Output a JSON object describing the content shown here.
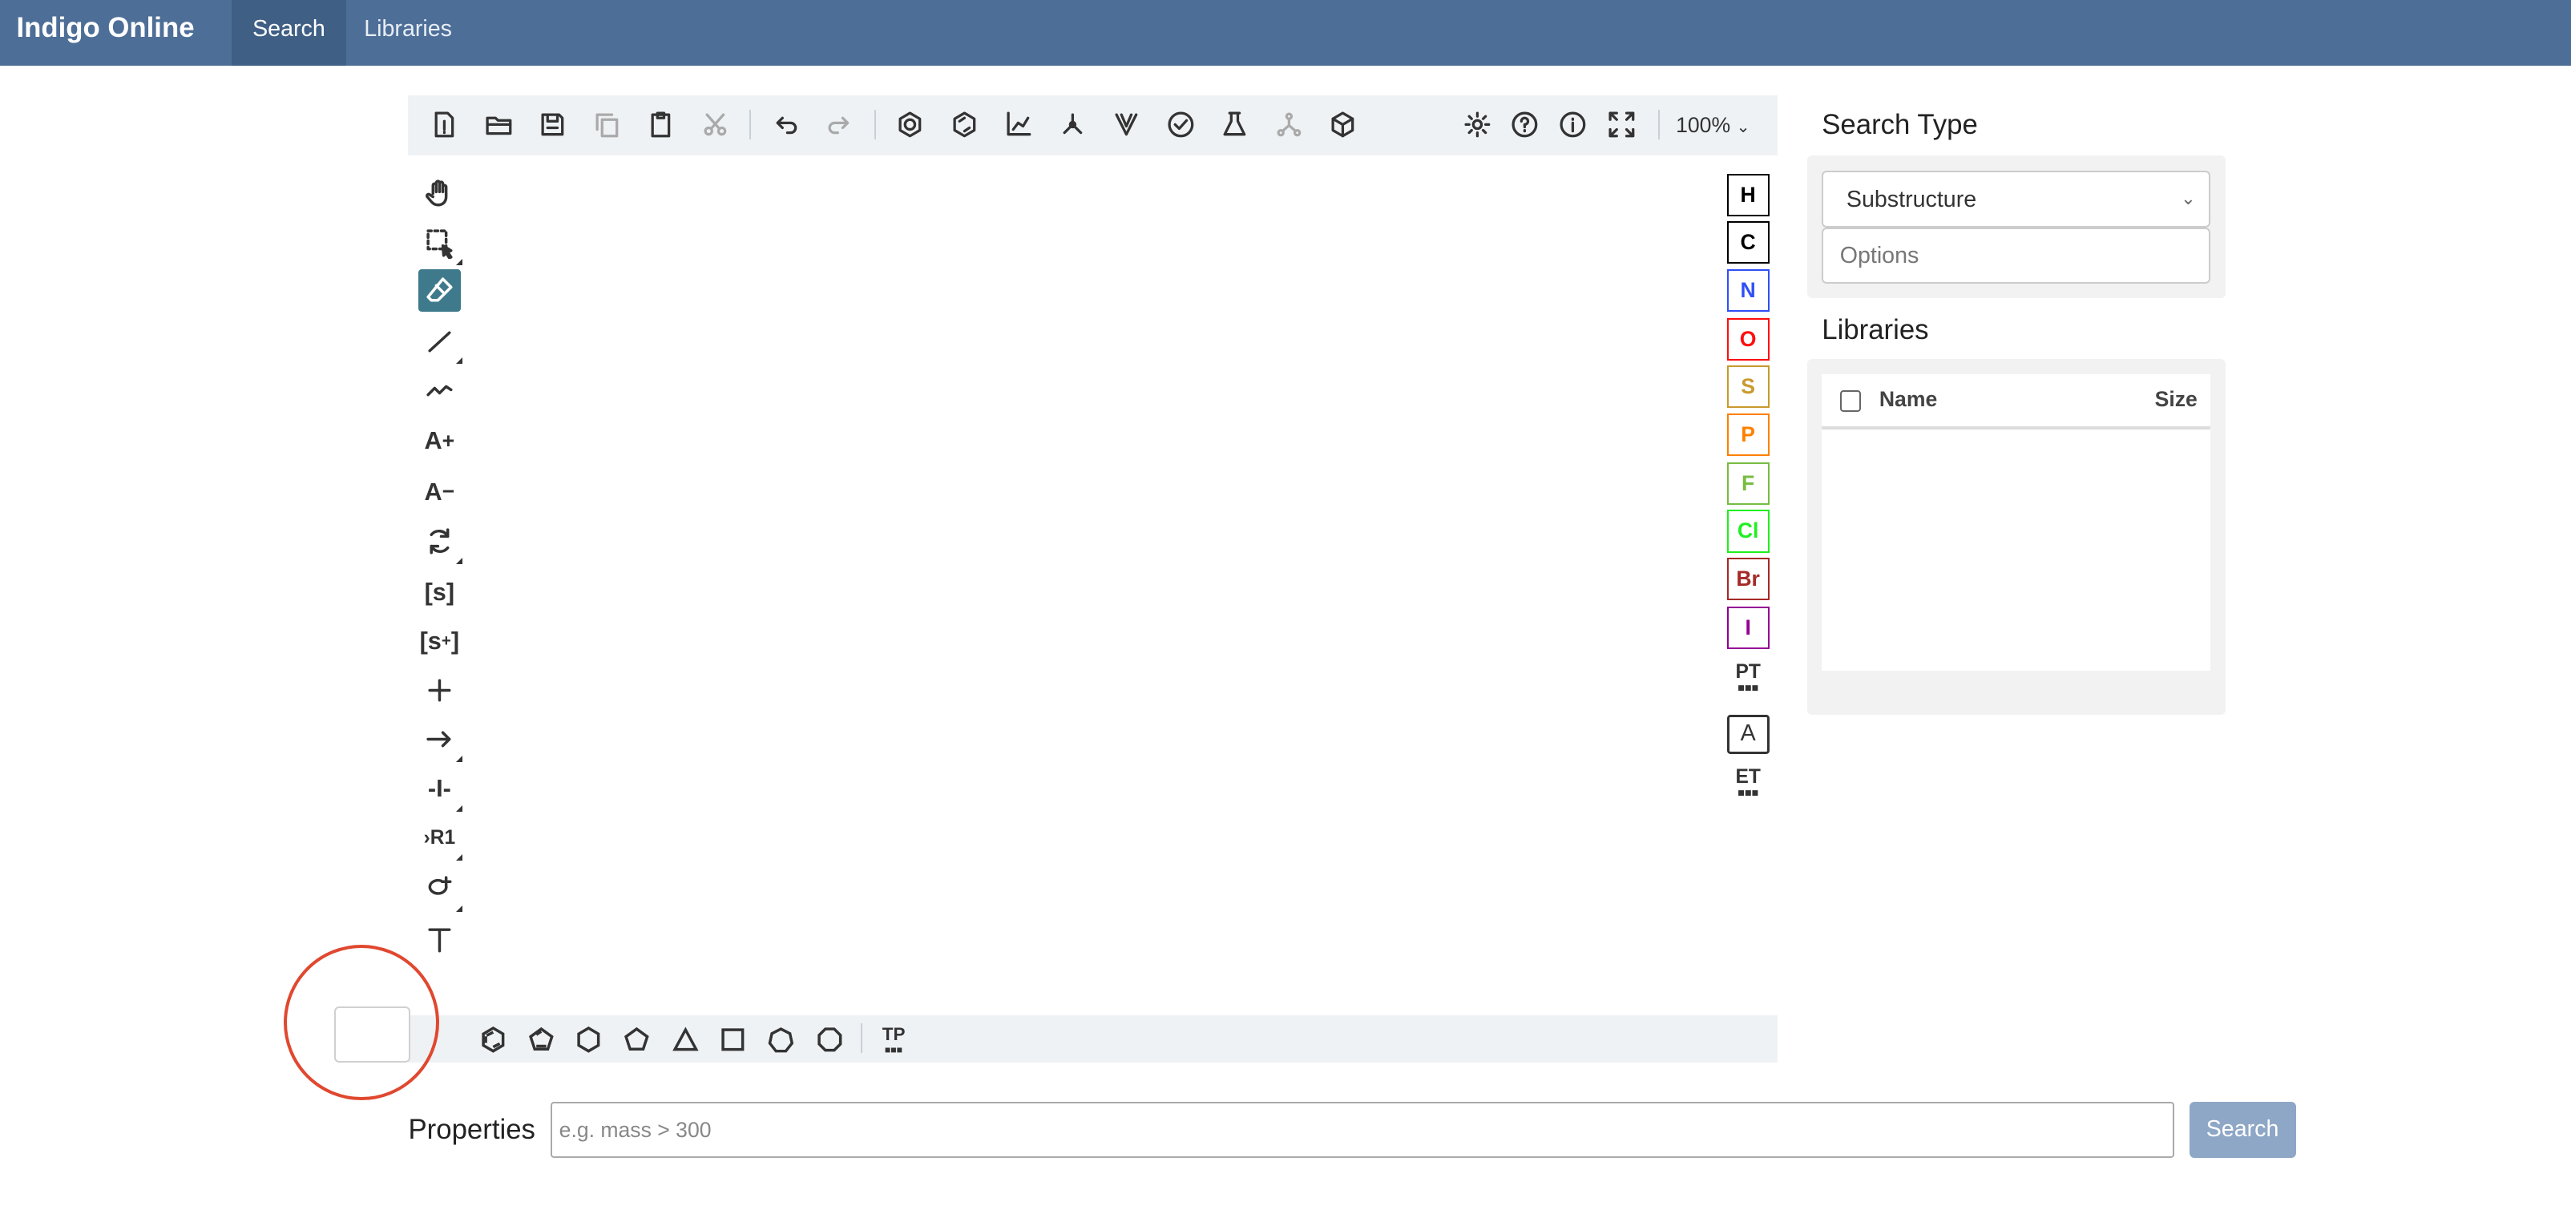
{
  "nav": {
    "brand": "Indigo Online",
    "tabs": [
      {
        "label": "Search"
      },
      {
        "label": "Libraries"
      }
    ]
  },
  "editor": {
    "zoom": "100%",
    "top_icons": [
      "new-file-icon",
      "open-icon",
      "save-icon",
      "copy-icon",
      "paste-icon",
      "cut-icon",
      "undo-icon",
      "redo-icon",
      "aromatize-icon",
      "dearomatize-icon",
      "layout-icon",
      "clean-icon",
      "stereo-icon",
      "check-icon",
      "analyse-icon",
      "recognize-icon",
      "3d-view-icon",
      "settings-icon",
      "help-icon",
      "about-icon",
      "fullscreen-icon"
    ],
    "left_tools": [
      "hand-tool",
      "select-tool",
      "erase-tool",
      "bond-tool",
      "chain-tool",
      "charge-plus",
      "charge-minus",
      "transform-tool",
      "sgroup-tool",
      "sgroup-data-tool",
      "reaction-plus-tool",
      "arrow-tool",
      "mapping-tool",
      "rgroup-tool",
      "attachment-tool",
      "text-tool"
    ],
    "atoms": [
      {
        "label": "H",
        "color": "#000000"
      },
      {
        "label": "C",
        "color": "#000000"
      },
      {
        "label": "N",
        "color": "#304ff7"
      },
      {
        "label": "O",
        "color": "#ff0d0d"
      },
      {
        "label": "S",
        "color": "#c99a2e"
      },
      {
        "label": "P",
        "color": "#ff8000"
      },
      {
        "label": "F",
        "color": "#78bc42"
      },
      {
        "label": "Cl",
        "color": "#1ff01f"
      },
      {
        "label": "Br",
        "color": "#a62929"
      },
      {
        "label": "I",
        "color": "#940094"
      }
    ],
    "atom_extra": {
      "pt": "PT",
      "any_atom": "A",
      "et": "ET"
    },
    "templates": [
      "benzene",
      "cyclopentadiene",
      "cyclohexane",
      "cyclopentane",
      "cyclopropane",
      "cyclobutane",
      "cycloheptane",
      "cyclooctane"
    ],
    "template_lib": "TP"
  },
  "search_panel": {
    "title": "Search Type",
    "search_type": "Substructure",
    "options_placeholder": "Options",
    "libraries_title": "Libraries",
    "columns": {
      "name": "Name",
      "size": "Size"
    }
  },
  "properties": {
    "label": "Properties",
    "placeholder": "e.g. mass > 300",
    "button": "Search"
  }
}
